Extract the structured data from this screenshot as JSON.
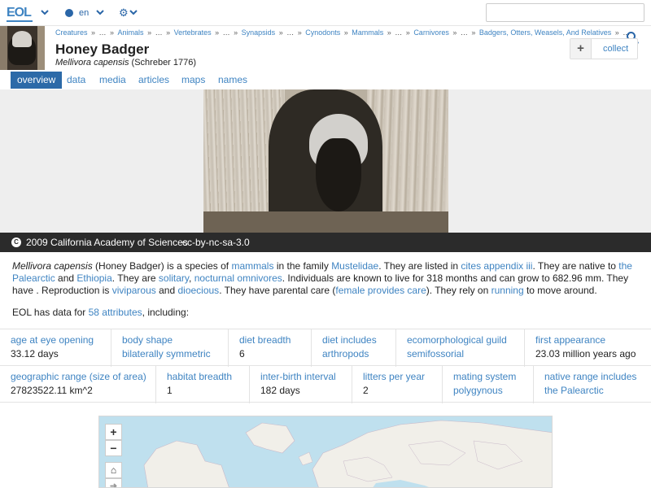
{
  "topbar": {
    "logo": "EOL",
    "language": "en",
    "search_placeholder": ""
  },
  "header": {
    "breadcrumbs": [
      "Creatures",
      "…",
      "Animals",
      "…",
      "Vertebrates",
      "…",
      "Synapsids",
      "…",
      "Cynodonts",
      "Mammals",
      "…",
      "Carnivores",
      "…",
      "Badgers, Otters, Weasels, And Relatives",
      "…"
    ],
    "title": "Honey Badger",
    "scientific_name": "Mellivora capensis",
    "authority": "(Schreber 1776)",
    "collect_label": "collect",
    "collect_plus": "+"
  },
  "tabs": [
    {
      "label": "overview",
      "active": true
    },
    {
      "label": "data",
      "active": false
    },
    {
      "label": "media",
      "active": false
    },
    {
      "label": "articles",
      "active": false
    },
    {
      "label": "maps",
      "active": false
    },
    {
      "label": "names",
      "active": false
    }
  ],
  "hero": {
    "owner": "2009 California Academy of Sciences",
    "license": "cc-by-nc-sa-3.0"
  },
  "summary": {
    "sci": "Mellivora capensis",
    "t1": " (Honey Badger) is a species of ",
    "l_mammals": "mammals",
    "t2": " in the family ",
    "l_mustelidae": "Mustelidae",
    "t3": ". They are listed in ",
    "l_cites": "cites appendix iii",
    "t4": ". They are native to ",
    "l_palearctic": "the Palearctic",
    "t5": " and ",
    "l_ethiopia": "Ethiopia",
    "t6": ". They are ",
    "l_solitary": "solitary",
    "t7": ", ",
    "l_nocturnal": "nocturnal omnivores",
    "t8": ". Individuals are known to live for 318 months and can grow to 682.96 mm. They have . Reproduction is ",
    "l_viviparous": "viviparous",
    "t9": " and ",
    "l_dioecious": "dioecious",
    "t10": ". They have parental care (",
    "l_female": "female provides care",
    "t11": "). They rely on ",
    "l_running": "running",
    "t12": " to move around."
  },
  "data_for": {
    "prefix": "EOL has data for ",
    "link": "58 attributes",
    "suffix": ", including:"
  },
  "attributes_row1": [
    {
      "key": "age at eye opening",
      "value": "33.12 days",
      "value_is_link": false
    },
    {
      "key": "body shape",
      "value": "bilaterally symmetric",
      "value_is_link": true
    },
    {
      "key": "diet breadth",
      "value": "6",
      "value_is_link": false
    },
    {
      "key": "diet includes",
      "value": "arthropods",
      "value_is_link": true
    },
    {
      "key": "ecomorphological guild",
      "value": "semifossorial",
      "value_is_link": true
    },
    {
      "key": "first appearance",
      "value": "23.03 million years ago",
      "value_is_link": false
    }
  ],
  "attributes_row2": [
    {
      "key": "geographic range (size of area)",
      "value": "27823522.11 km^2",
      "value_is_link": false
    },
    {
      "key": "habitat breadth",
      "value": "1",
      "value_is_link": false
    },
    {
      "key": "inter-birth interval",
      "value": "182 days",
      "value_is_link": false
    },
    {
      "key": "litters per year",
      "value": "2",
      "value_is_link": false
    },
    {
      "key": "mating system",
      "value": "polygynous",
      "value_is_link": true
    },
    {
      "key": "native range includes",
      "value": "the Palearctic",
      "value_is_link": true
    }
  ],
  "map": {
    "zoom_in": "+",
    "zoom_out": "−",
    "home": "⌂",
    "next": "➜"
  },
  "colors": {
    "link": "#3f84c2",
    "tab_active": "#2c6aa8",
    "caption_bg": "#2b2b2b",
    "map_water": "#bfe0ee",
    "map_land": "#f1efe9"
  }
}
